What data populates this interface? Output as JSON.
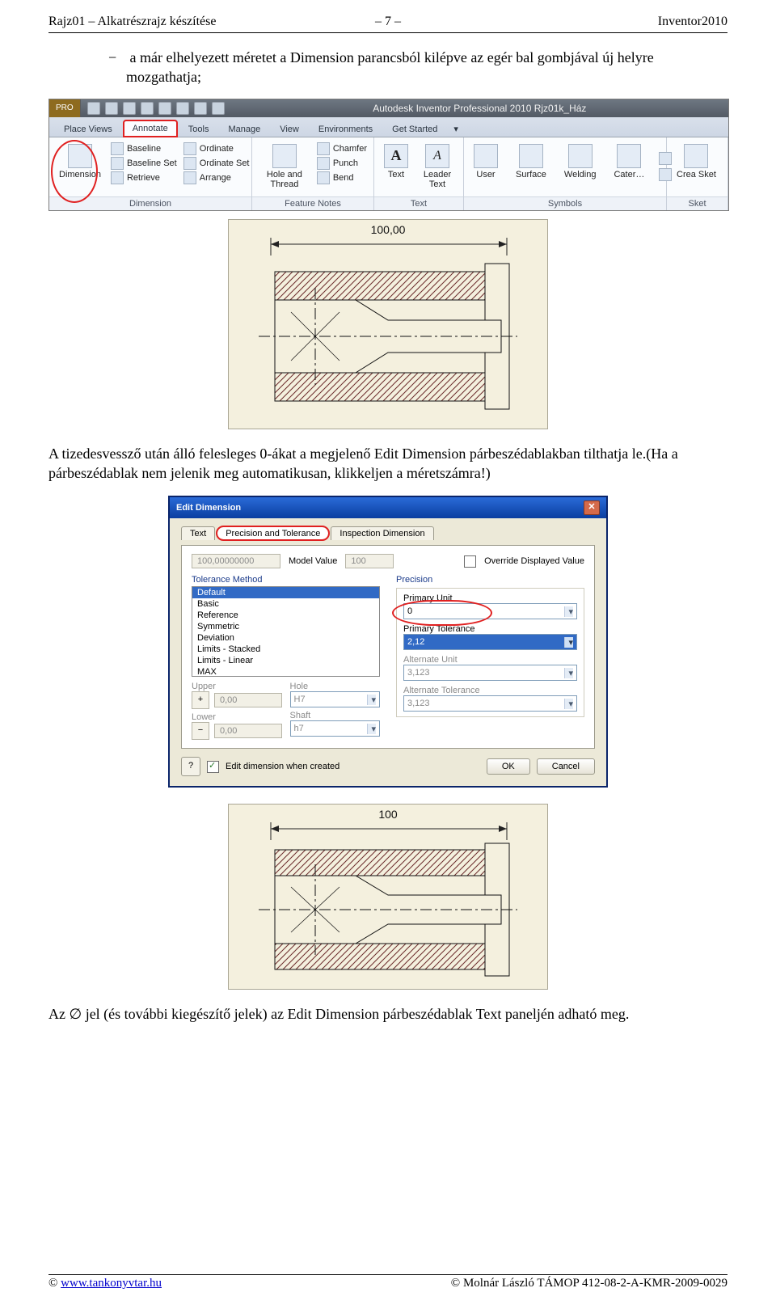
{
  "header": {
    "left": "Rajz01 – Alkatrészrajz készítése",
    "center": "– 7 –",
    "right": "Inventor2010"
  },
  "bullet": {
    "text": "a már elhelyezett méretet a Dimension parancsból kilépve az egér bal gombjával új helyre mozgathatja;"
  },
  "ribbon": {
    "pro": "PRO",
    "titlebar": "Autodesk Inventor Professional 2010    Rjz01k_Ház",
    "tabs": [
      "Place Views",
      "Annotate",
      "Tools",
      "Manage",
      "View",
      "Environments",
      "Get Started"
    ],
    "panelDimension": {
      "left": [
        [
          "Baseline",
          "Baseline Set",
          "Retrieve"
        ],
        [
          "Ordinate",
          "Ordinate Set",
          "Arrange"
        ]
      ],
      "big": "Dimension",
      "label": "Dimension"
    },
    "panelFeature": {
      "big": "Hole and Thread",
      "right": [
        "Chamfer",
        "Punch",
        "Bend"
      ],
      "label": "Feature Notes"
    },
    "panelText": {
      "b1": "Text",
      "b2": "Leader Text",
      "label": "Text"
    },
    "panelSymbols": {
      "items": [
        "User",
        "Surface",
        "Welding",
        "Cater…"
      ],
      "label": "Symbols"
    },
    "panelSketch": {
      "big": "Crea Sket",
      "label": "Sket"
    }
  },
  "drawing1": {
    "dim": "100,00"
  },
  "para1": "A tizedesvessző után álló felesleges 0-ákat a megjelenő Edit Dimension párbeszédablakban tilthatja le.(Ha a párbeszédablak nem jelenik meg automatikusan, klikkeljen a méretszámra!)",
  "dialog": {
    "title": "Edit Dimension",
    "tabs": [
      "Text",
      "Precision and Tolerance",
      "Inspection Dimension"
    ],
    "modelField": "100,00000000",
    "modelLabel": "Model Value",
    "nominal": "100",
    "override": "Override Displayed Value",
    "tolMethod": "Tolerance Method",
    "tolList": [
      "Default",
      "Basic",
      "Reference",
      "Symmetric",
      "Deviation",
      "Limits - Stacked",
      "Limits - Linear",
      "MAX"
    ],
    "upper": "Upper",
    "lower": "Lower",
    "upperVal": "0,00",
    "lowerVal": "0,00",
    "hole": "Hole",
    "shaft": "Shaft",
    "holeVal": "H7",
    "shaftVal": "h7",
    "precision": "Precision",
    "primaryUnit": "Primary Unit",
    "primaryUnitVal": "0",
    "primaryTol": "Primary Tolerance",
    "primaryTolVal": "2,12",
    "altUnit": "Alternate Unit",
    "altUnitVal": "3,123",
    "altTol": "Alternate Tolerance",
    "altTolVal": "3,123",
    "editWhen": "Edit dimension when created",
    "ok": "OK",
    "cancel": "Cancel"
  },
  "drawing2": {
    "dim": "100"
  },
  "para2_pre": "Az ",
  "para2_sym": "∅",
  "para2_post": " jel (és további kiegészítő jelek) az Edit Dimension párbeszédablak Text paneljén adható meg.",
  "footer": {
    "left": "www.tankonyvtar.hu",
    "left_prefix": "© ",
    "right": "© Molnár László TÁMOP 412-08-2-A-KMR-2009-0029"
  }
}
